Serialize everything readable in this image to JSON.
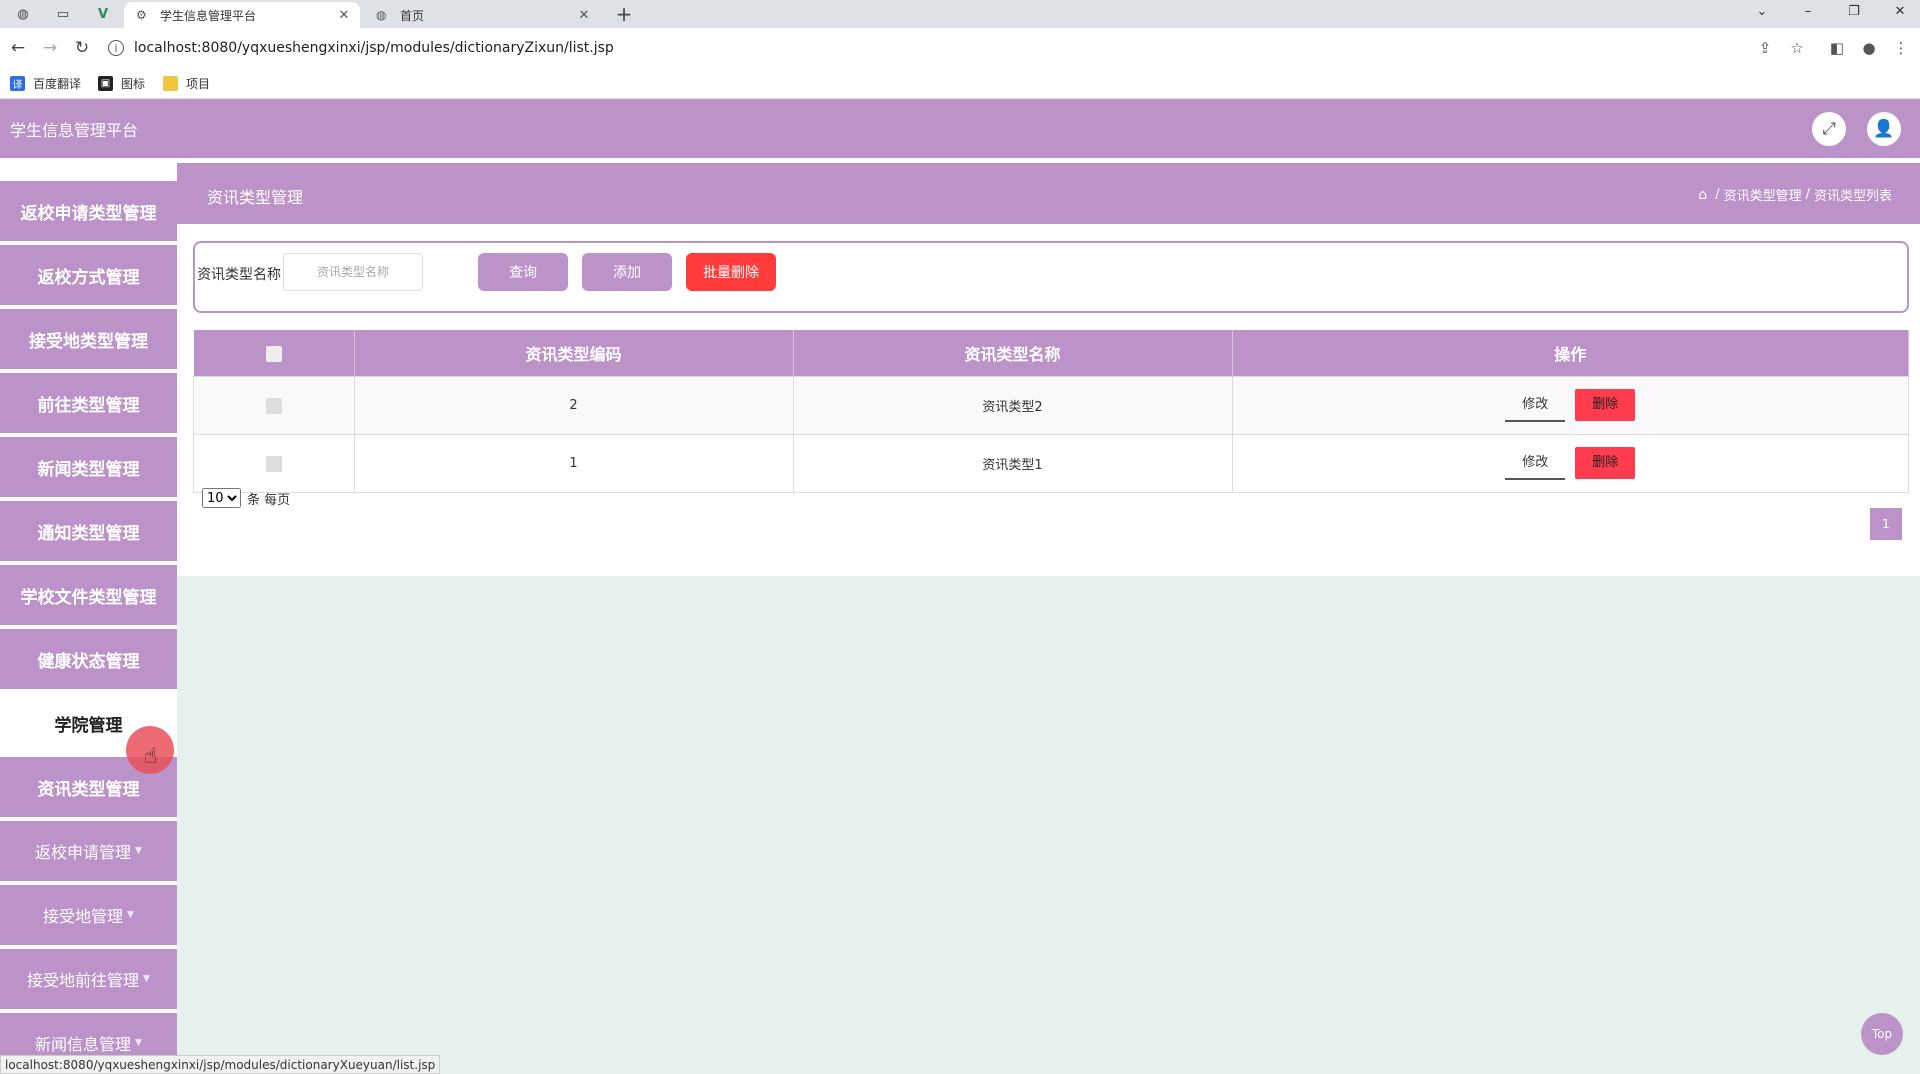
{
  "browser": {
    "tabs": [
      {
        "title": "学生信息管理平台",
        "active": true
      },
      {
        "title": "首页",
        "active": false
      }
    ],
    "url": "localhost:8080/yqxueshengxinxi/jsp/modules/dictionaryZixun/list.jsp",
    "bookmarks": [
      {
        "label": "百度翻译",
        "icon": "translate-icon"
      },
      {
        "label": "图标",
        "icon": "image-icon"
      },
      {
        "label": "项目",
        "icon": "folder-icon"
      }
    ],
    "status_url": "localhost:8080/yqxueshengxinxi/jsp/modules/dictionaryXueyuan/list.jsp"
  },
  "app": {
    "title": "学生信息管理平台",
    "accent": "#bc93c8"
  },
  "sidebar": {
    "items": [
      {
        "label": "返校申请类型管理",
        "active": false,
        "has_caret": false
      },
      {
        "label": "返校方式管理",
        "active": false,
        "has_caret": false
      },
      {
        "label": "接受地类型管理",
        "active": false,
        "has_caret": false
      },
      {
        "label": "前往类型管理",
        "active": false,
        "has_caret": false
      },
      {
        "label": "新闻类型管理",
        "active": false,
        "has_caret": false
      },
      {
        "label": "通知类型管理",
        "active": false,
        "has_caret": false
      },
      {
        "label": "学校文件类型管理",
        "active": false,
        "has_caret": false
      },
      {
        "label": "健康状态管理",
        "active": false,
        "has_caret": false
      },
      {
        "label": "学院管理",
        "active": true,
        "has_caret": false
      },
      {
        "label": "资讯类型管理",
        "active": false,
        "has_caret": false
      },
      {
        "label": "返校申请管理",
        "active": false,
        "has_caret": true
      },
      {
        "label": "接受地管理",
        "active": false,
        "has_caret": true
      },
      {
        "label": "接受地前往管理",
        "active": false,
        "has_caret": true
      },
      {
        "label": "新闻信息管理",
        "active": false,
        "has_caret": true
      }
    ]
  },
  "page": {
    "title": "资讯类型管理",
    "breadcrumb": [
      "资讯类型管理",
      "资讯类型列表"
    ]
  },
  "search": {
    "label": "资讯类型名称",
    "placeholder": "资讯类型名称",
    "query_label": "查询",
    "add_label": "添加",
    "batch_delete_label": "批量删除"
  },
  "table": {
    "columns": [
      "资讯类型编码",
      "资讯类型名称",
      "操作"
    ],
    "rows": [
      {
        "code": "2",
        "name": "资讯类型2"
      },
      {
        "code": "1",
        "name": "资讯类型1"
      }
    ],
    "edit_label": "修改",
    "delete_label": "删除"
  },
  "pagination": {
    "page_size": "10",
    "page_size_options": [
      "10"
    ],
    "per_page_text": "条 每页",
    "current_page": "1"
  },
  "top_button": "Top"
}
